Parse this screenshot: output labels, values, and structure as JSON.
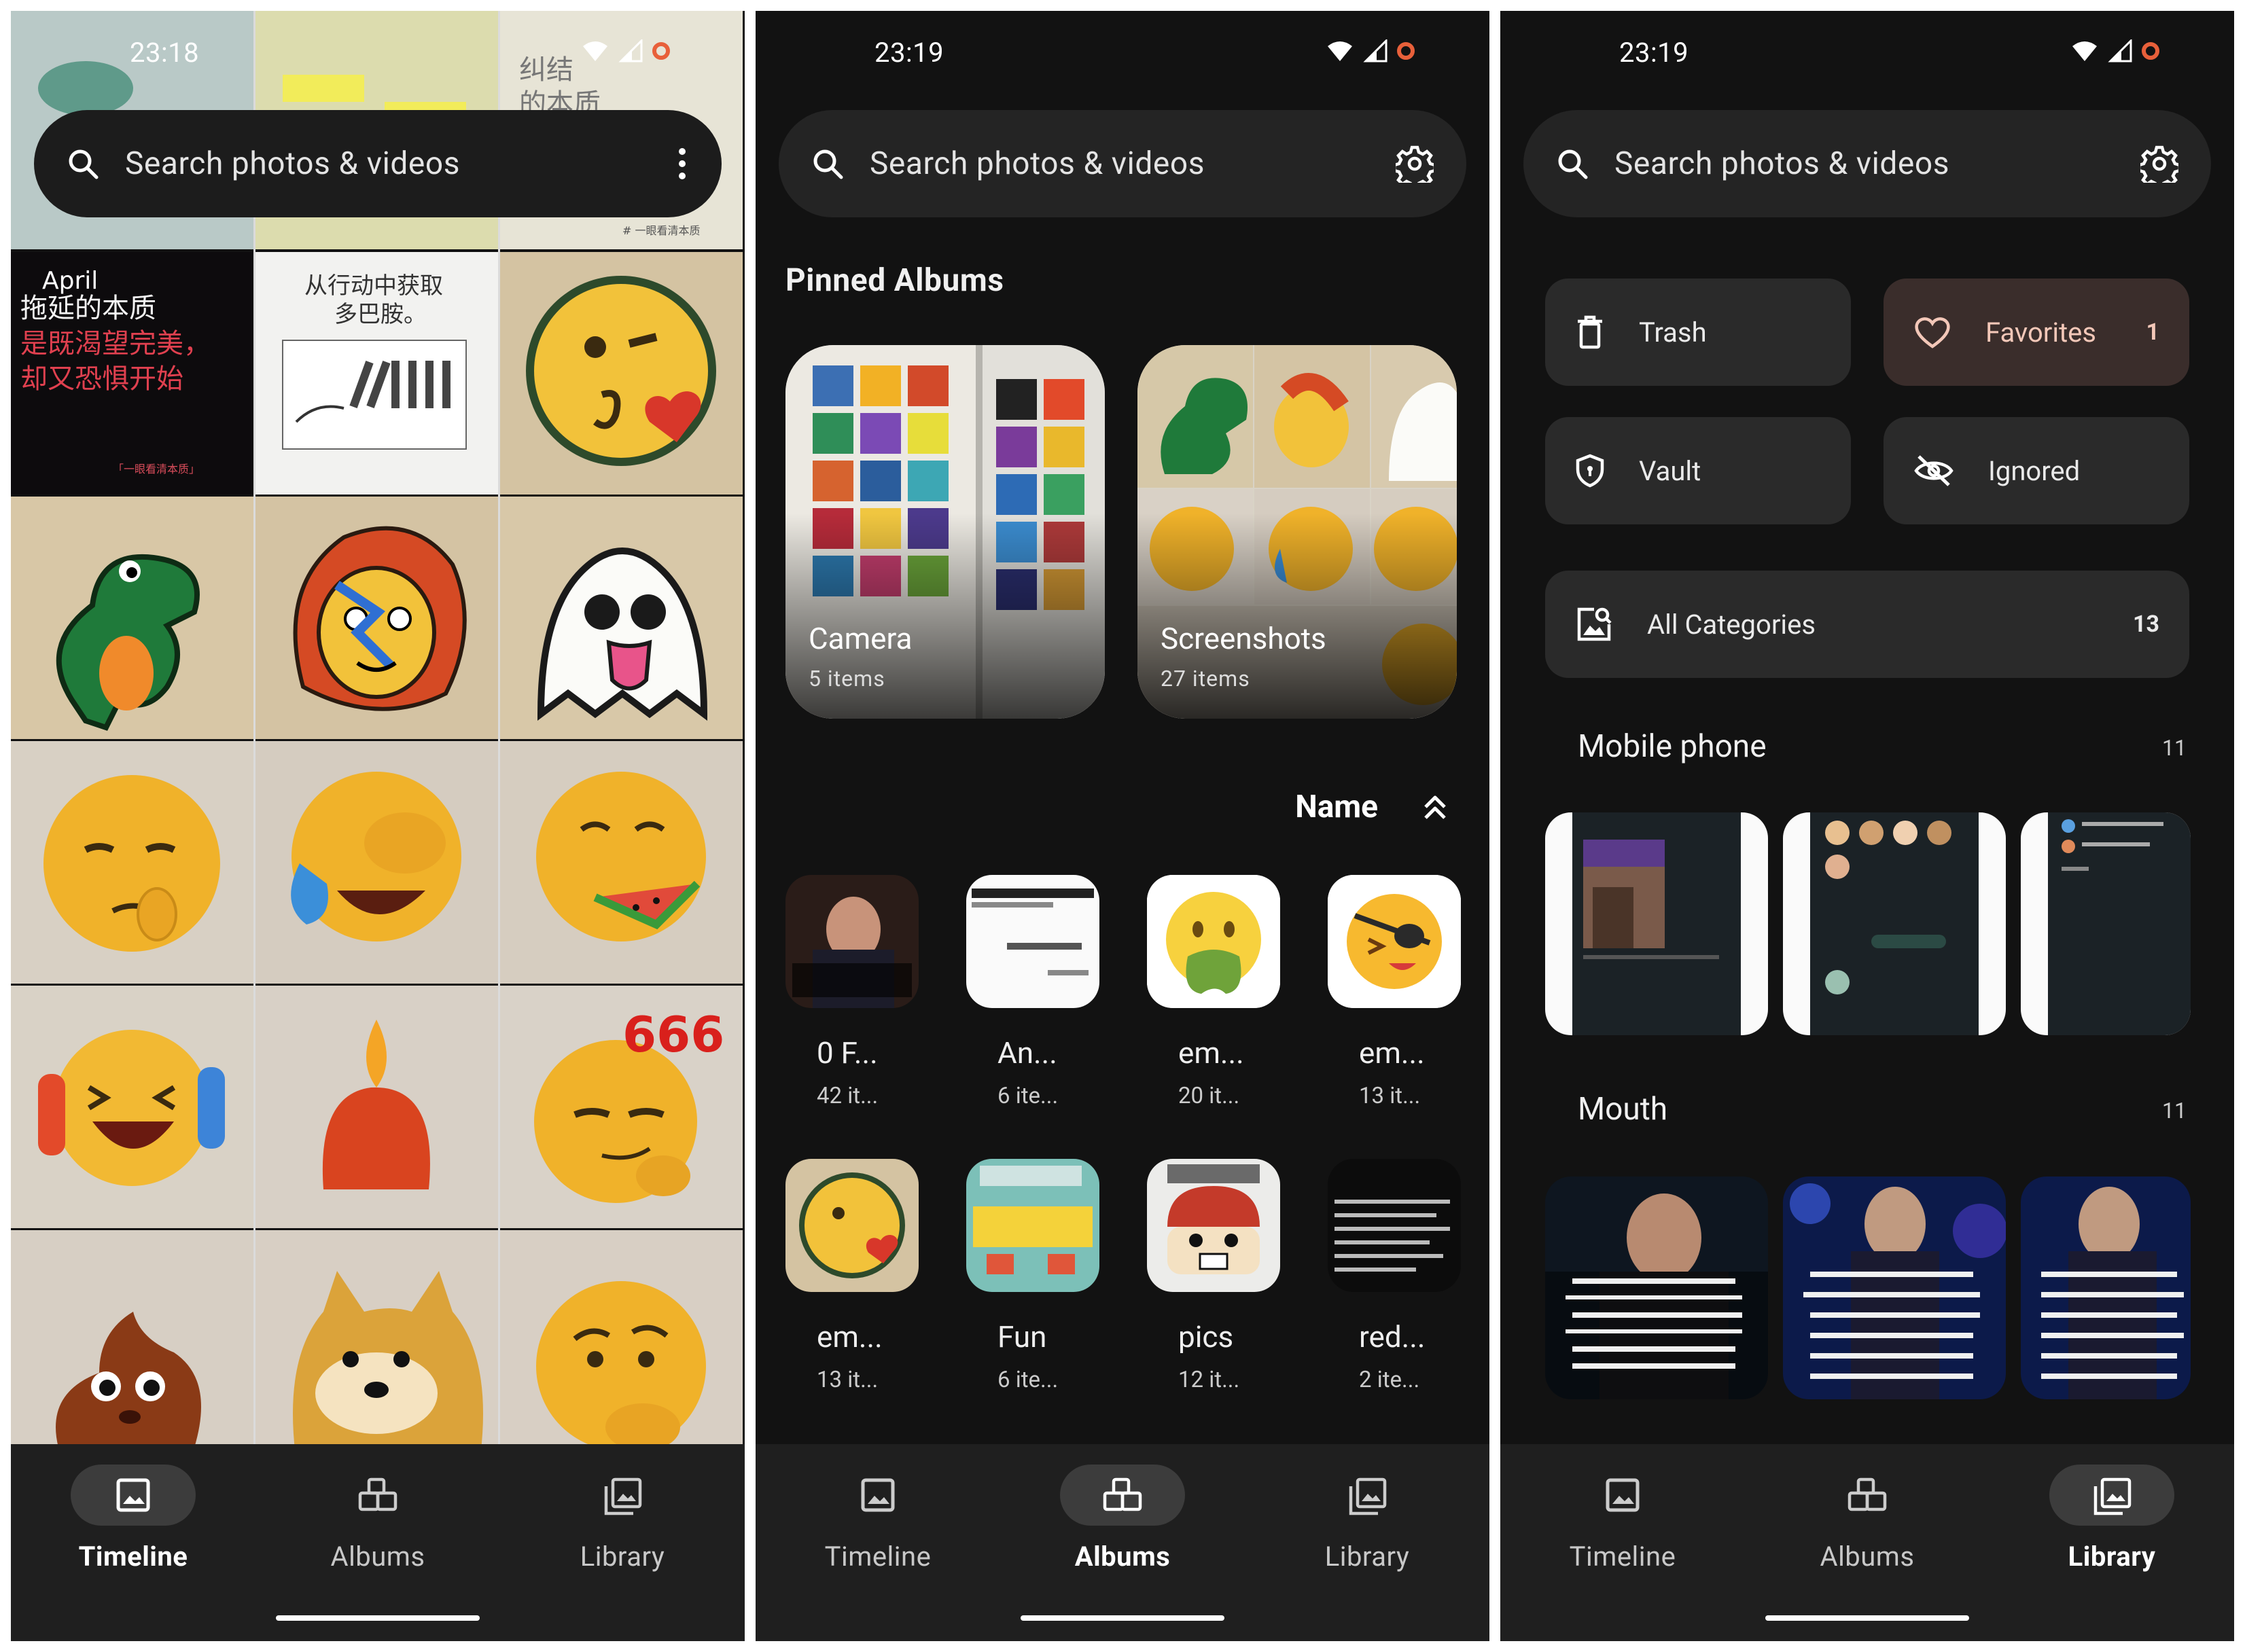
{
  "status": {
    "p1_time": "23:18",
    "p2_time": "23:19",
    "p3_time": "23:19"
  },
  "search": {
    "placeholder": "Search photos & videos"
  },
  "nav": {
    "timeline": "Timeline",
    "albums": "Albums",
    "library": "Library"
  },
  "timeline": {
    "tile_texts": {
      "t1_top": "纠结",
      "t1_top2": "的本质",
      "t2_title": "April",
      "t2_line1": "拖延的本质",
      "t2_line2": "是既渴望完美，",
      "t2_line3": "却又恐惧开始",
      "t2_footer": "「一眼看清本质」",
      "t3_line1": "从行动中获取",
      "t3_line2": "多巴胺。",
      "t4_footer": "# 一眼看清本质",
      "emoji_666": "666"
    }
  },
  "albums": {
    "pinned_heading": "Pinned Albums",
    "pinned": [
      {
        "name": "Camera",
        "count": "5 items"
      },
      {
        "name": "Screenshots",
        "count": "27 items"
      }
    ],
    "sort_label": "Name",
    "list": [
      {
        "name": "0 F...",
        "count": "42 it..."
      },
      {
        "name": "An...",
        "count": "6 ite..."
      },
      {
        "name": "em...",
        "count": "20 it..."
      },
      {
        "name": "em...",
        "count": "13 it..."
      },
      {
        "name": "em...",
        "count": "13 it..."
      },
      {
        "name": "Fun",
        "count": "6 ite..."
      },
      {
        "name": "pics",
        "count": "12 it..."
      },
      {
        "name": "red...",
        "count": "2 ite..."
      }
    ]
  },
  "library": {
    "buttons": {
      "trash": "Trash",
      "favorites": "Favorites",
      "favorites_count": "1",
      "vault": "Vault",
      "ignored": "Ignored",
      "all_categories": "All Categories",
      "all_categories_count": "13"
    },
    "categories": [
      {
        "name": "Mobile phone",
        "count": "11"
      },
      {
        "name": "Mouth",
        "count": "11"
      }
    ]
  },
  "colors": {
    "background": "#121212",
    "surface": "#242424",
    "nav": "#1f1f1f",
    "favorites_bg": "#3a2d2b",
    "favorites_fg": "#f3c7b8",
    "record_indicator": "#e8603a"
  }
}
